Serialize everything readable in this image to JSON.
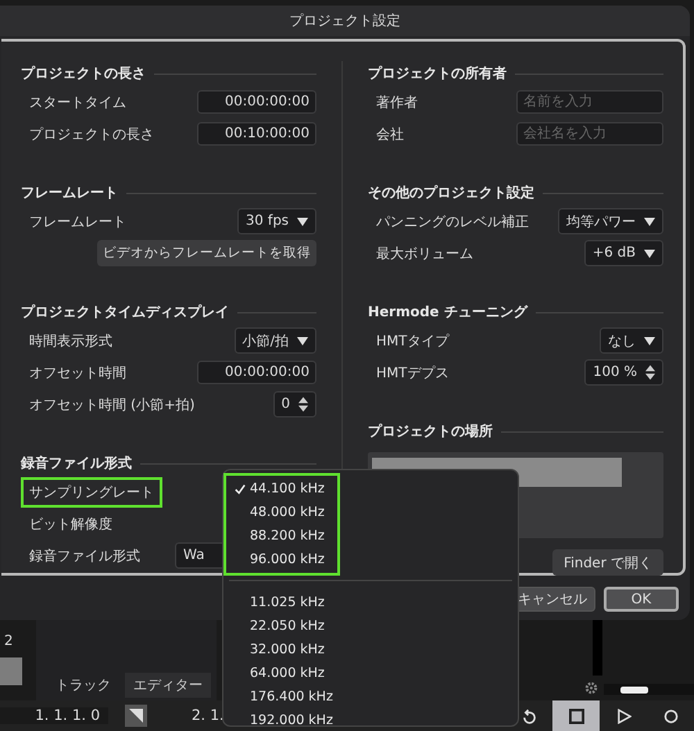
{
  "window": {
    "title": "プロジェクト設定"
  },
  "left_sections": [
    {
      "title": "プロジェクトの長さ",
      "rows": [
        {
          "label": "スタートタイム",
          "kind": "field",
          "value": "00:00:00:00"
        },
        {
          "label": "プロジェクトの長さ",
          "kind": "field",
          "value": "00:10:00:00"
        }
      ]
    },
    {
      "title": "フレームレート",
      "rows": [
        {
          "label": "フレームレート",
          "kind": "select",
          "value": "30 fps"
        },
        {
          "kind": "button",
          "value": "ビデオからフレームレートを取得"
        }
      ]
    },
    {
      "title": "プロジェクトタイムディスプレイ",
      "rows": [
        {
          "label": "時間表示形式",
          "kind": "select",
          "value": "小節/拍"
        },
        {
          "label": "オフセット時間",
          "kind": "field",
          "value": "00:00:00:00"
        },
        {
          "label": "オフセット時間 (小節+拍)",
          "kind": "stepper",
          "value": "0"
        }
      ]
    },
    {
      "title": "録音ファイル形式",
      "rows": [
        {
          "label": "サンプリングレート",
          "kind": "label",
          "highlighted": true
        },
        {
          "label": "ビット解像度",
          "kind": "label",
          "highlighted": false
        },
        {
          "label": "録音ファイル形式",
          "kind": "select-cut",
          "value": "Wa"
        }
      ]
    }
  ],
  "right_sections": [
    {
      "title": "プロジェクトの所有者",
      "rows": [
        {
          "label": "著作者",
          "kind": "input",
          "placeholder": "名前を入力"
        },
        {
          "label": "会社",
          "kind": "input",
          "placeholder": "会社名を入力"
        }
      ]
    },
    {
      "title": "その他のプロジェクト設定",
      "rows": [
        {
          "label": "パンニングのレベル補正",
          "kind": "select",
          "value": "均等パワー"
        },
        {
          "label": "最大ボリューム",
          "kind": "select",
          "value": "+6 dB"
        }
      ]
    },
    {
      "title": "Hermode チューニング",
      "rows": [
        {
          "label": "HMTタイプ",
          "kind": "select",
          "value": "なし"
        },
        {
          "label": "HMTデプス",
          "kind": "stepper",
          "value": "100 %"
        }
      ]
    },
    {
      "title": "プロジェクトの場所",
      "rows": [
        {
          "kind": "location",
          "value": "Finder で開く"
        }
      ]
    }
  ],
  "buttons": [
    {
      "label": "キャンセル",
      "default": false
    },
    {
      "label": "OK",
      "default": true
    }
  ],
  "dropdown": {
    "groups": [
      {
        "highlighted": true,
        "items": [
          {
            "label": "44.100 kHz",
            "checked": true
          },
          {
            "label": "48.000 kHz",
            "checked": false
          },
          {
            "label": "88.200 kHz",
            "checked": false
          },
          {
            "label": "96.000 kHz",
            "checked": false
          }
        ]
      },
      {
        "highlighted": false,
        "items": [
          {
            "label": "11.025 kHz",
            "checked": false
          },
          {
            "label": "22.050 kHz",
            "checked": false
          },
          {
            "label": "32.000 kHz",
            "checked": false
          },
          {
            "label": "64.000 kHz",
            "checked": false
          },
          {
            "label": "176.400 kHz",
            "checked": false
          },
          {
            "label": "192.000 kHz",
            "checked": false
          }
        ]
      }
    ]
  },
  "daw": {
    "track_number": "2",
    "tabs": [
      {
        "label": "トラック",
        "selected": false
      },
      {
        "label": "エディター",
        "selected": true
      }
    ],
    "position_left": "1. 1. 1. 0",
    "position_right": "2. 1."
  }
}
